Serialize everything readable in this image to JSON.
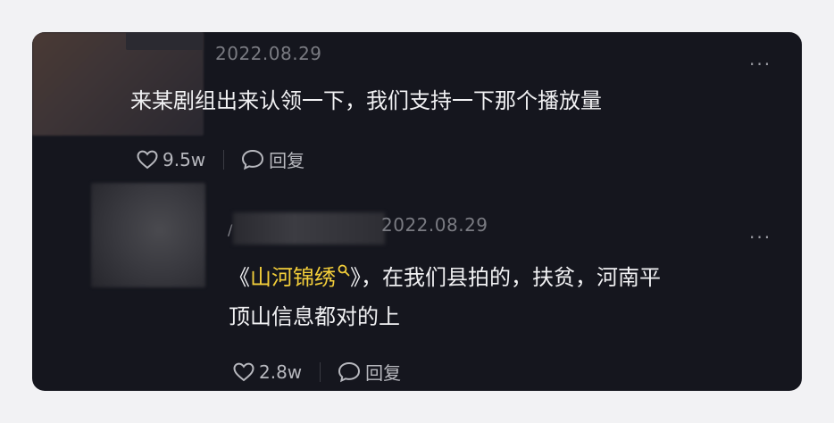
{
  "comments": [
    {
      "timestamp": "2022.08.29",
      "more_label": "...",
      "text": "来某剧组出来认领一下，我们支持一下那个播放量",
      "likes": "9.5w",
      "reply_label": "回复"
    },
    {
      "name_prefix": "/",
      "timestamp": "2022.08.29",
      "more_label": "...",
      "text_before": "《",
      "tag_text": "山河锦绣",
      "text_after_line1": "》，在我们县拍的，扶贫，河南平",
      "text_line2": "顶山信息都对的上",
      "likes": "2.8w",
      "reply_label": "回复"
    }
  ],
  "colors": {
    "card_bg": "#15161e",
    "page_bg": "#f2f2f4",
    "tag": "#f4cf3a",
    "text": "#f1f1f3",
    "muted": "#7a7b82"
  },
  "icons": [
    "heart-icon",
    "comment-bubble-icon",
    "search-icon"
  ]
}
